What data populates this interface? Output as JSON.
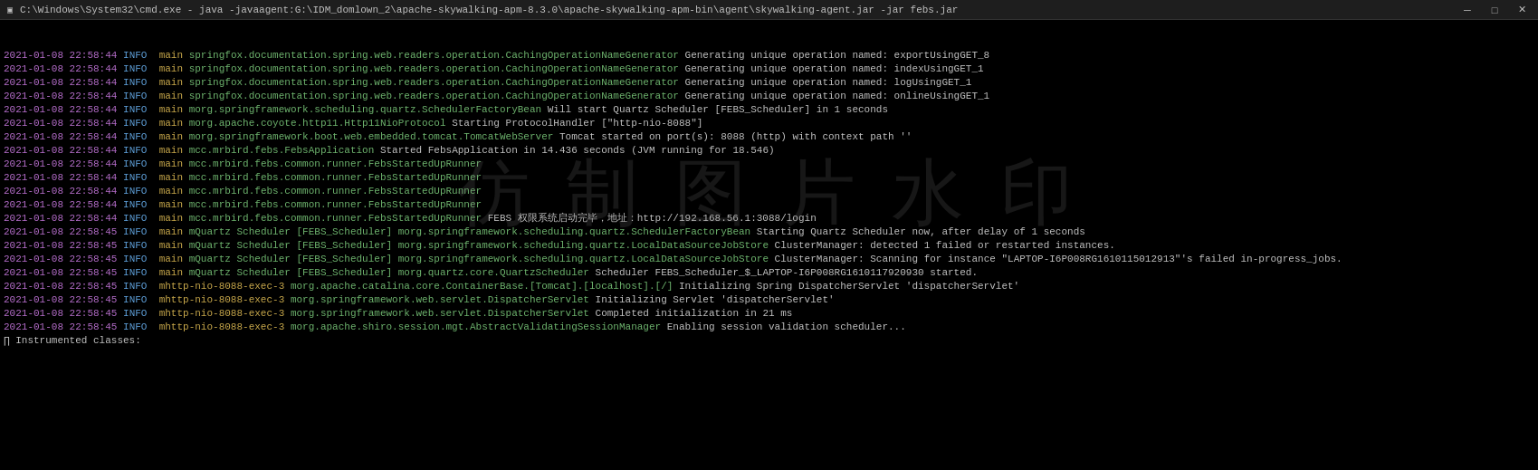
{
  "titleBar": {
    "title": "C:\\Windows\\System32\\cmd.exe - java  -javaagent:G:\\IDM_domlown_2\\apache-skywalking-apm-8.3.0\\apache-skywalking-apm-bin\\agent\\skywalking-agent.jar -jar febs.jar",
    "iconSymbol": "▣",
    "minimizeLabel": "─",
    "maximizeLabel": "□",
    "closeLabel": "✕"
  },
  "console": {
    "lines": [
      "[0;35m2021-01-08 22:58:44[0;39m [0;34mINFO [0;39m [0;33mmain[0;39m [0;32mspringfox.documentation.spring.web.readers.operation.CachingOperationNameGenerator[0;39m Generating unique operation named: exportUsingGET_8",
      "[0;35m2021-01-08 22:58:44[0;39m [0;34mINFO [0;39m [0;33mmain[0;39m [0;32mspringfox.documentation.spring.web.readers.operation.CachingOperationNameGenerator[0;39m Generating unique operation named: indexUsingGET_1",
      "[0;35m2021-01-08 22:58:44[0;39m [0;34mINFO [0;39m [0;33mmain[0;39m [0;32mspringfox.documentation.spring.web.readers.operation.CachingOperationNameGenerator[0;39m Generating unique operation named: logUsingGET_1",
      "[0;35m2021-01-08 22:58:44[0;39m [0;34mINFO [0;39m [0;33mmain[0;39m [0;32mspringfox.documentation.spring.web.readers.operation.CachingOperationNameGenerator[0;39m Generating unique operation named: onlineUsingGET_1",
      "[0;35m2021-01-08 22:58:44[0;39m [0;34mINFO [0;39m [0;33mmain[0;39m [0;32mmorg.springframework.scheduling.quartz.SchedulerFactoryBean[0;39m Will start Quartz Scheduler [FEBS_Scheduler] in 1 seconds",
      "[0;35m2021-01-08 22:58:44[0;39m [0;34mINFO [0;39m [0;33mmain[0;39m [0;32mmorg.apache.coyote.http11.Http11NioProtocol[0;39m Starting ProtocolHandler [\"http-nio-8088\"]",
      "[0;35m2021-01-08 22:58:44[0;39m [0;34mINFO [0;39m [0;33mmain[0;39m [0;32mmorg.springframework.boot.web.embedded.tomcat.TomcatWebServer[0;39m Tomcat started on port(s): 8088 (http) with context path ''",
      "[0;35m2021-01-08 22:58:44[0;39m [0;34mINFO [0;39m [0;33mmain[0;39m [0;32mmcc.mrbird.febs.FebsApplication[0;39m Started FebsApplication in 14.436 seconds (JVM running for 18.546)",
      "[0;35m2021-01-08 22:58:44[0;39m [0;34mINFO [0;39m [0;33mmain[0;39m [0;32mmcc.mrbird.febs.common.runner.FebsStartedUpRunner[0;39m",
      "[0;35m2021-01-08 22:58:44[0;39m [0;34mINFO [0;39m [0;33mmain[0;39m [0;32mmcc.mrbird.febs.common.runner.FebsStartedUpRunner[0;39m",
      "[0;35m2021-01-08 22:58:44[0;39m [0;34mINFO [0;39m [0;33mmain[0;39m [0;32mmcc.mrbird.febs.common.runner.FebsStartedUpRunner[0;39m",
      "[0;35m2021-01-08 22:58:44[0;39m [0;34mINFO [0;39m [0;33mmain[0;39m [0;32mmcc.mrbird.febs.common.runner.FebsStartedUpRunner[0;39m",
      "[0;35m2021-01-08 22:58:44[0;39m [0;34mINFO [0;39m [0;33mmain[0;39m [0;32mmcc.mrbird.febs.common.runner.FebsStartedUpRunner[0;39m FEBS 权限系统启动完毕，地址：http://192.168.56.1:3088/login",
      "[0;35m2021-01-08 22:58:45[0;39m [0;34mINFO [0;39m [0;33mmain[0;39m [0;32mmQuartz Scheduler [FEBS_Scheduler][0;39m [0;32mmorg.springframework.scheduling.quartz.SchedulerFactoryBean[0;39m Starting Quartz Scheduler now, after delay of 1 seconds",
      "[0;35m2021-01-08 22:58:45[0;39m [0;34mINFO [0;39m [0;33mmain[0;39m [0;32mmQuartz Scheduler [FEBS_Scheduler][0;39m [0;32mmorg.springframework.scheduling.quartz.LocalDataSourceJobStore[0;39m ClusterManager: detected 1 failed or restarted instances.",
      "[0;35m2021-01-08 22:58:45[0;39m [0;34mINFO [0;39m [0;33mmain[0;39m [0;32mmQuartz Scheduler [FEBS_Scheduler][0;39m [0;32mmorg.springframework.scheduling.quartz.LocalDataSourceJobStore[0;39m ClusterManager: Scanning for instance \"LAPTOP-I6P008RG1610115012913\"'s failed in-progress_jobs.",
      "[0;35m2021-01-08 22:58:45[0;39m [0;34mINFO [0;39m [0;33mmain[0;39m [0;32mmQuartz Scheduler [FEBS_Scheduler][0;39m [0;32mmorg.quartz.core.QuartzScheduler[0;39m Scheduler FEBS_Scheduler_$_LAPTOP-I6P008RG1610117920930 started.",
      "[0;35m2021-01-08 22:58:45[0;39m [0;34mINFO [0;39m [0;33mmhttp-nio-8088-exec-3[0;39m [0;32mmorg.apache.catalina.core.ContainerBase.[Tomcat].[localhost].[/][0;39m Initializing Spring DispatcherServlet 'dispatcherServlet'",
      "[0;35m2021-01-08 22:58:45[0;39m [0;34mINFO [0;39m [0;33mmhttp-nio-8088-exec-3[0;39m [0;32mmorg.springframework.web.servlet.DispatcherServlet[0;39m Initializing Servlet 'dispatcherServlet'",
      "[0;35m2021-01-08 22:58:45[0;39m [0;34mINFO [0;39m [0;33mmhttp-nio-8088-exec-3[0;39m [0;32mmorg.springframework.web.servlet.DispatcherServlet[0;39m Completed initialization in 21 ms",
      "[0;35m2021-01-08 22:58:45[0;39m [0;34mINFO [0;39m [0;33mmhttp-nio-8088-exec-3[0;39m [0;32mmorg.apache.shiro.session.mgt.AbstractValidatingSessionManager[0;39m Enabling session validation scheduler...",
      "∏ Instrumented classes:"
    ]
  },
  "watermark": {
    "text": "仿 制 图 片 水 印"
  }
}
